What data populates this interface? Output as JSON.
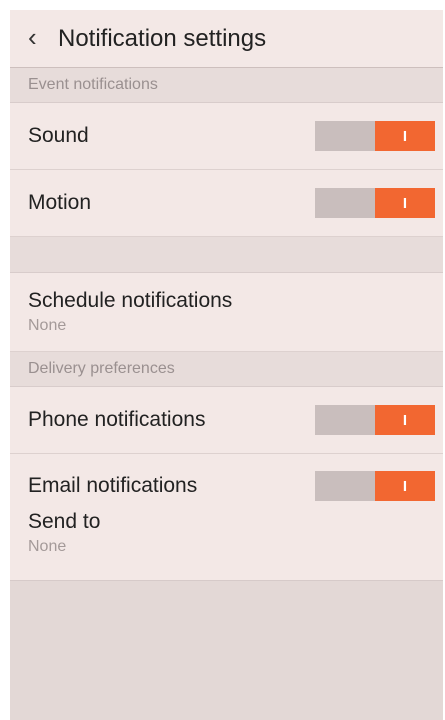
{
  "header": {
    "back_icon": "chevron-left-icon",
    "title": "Notification settings"
  },
  "sections": {
    "event": {
      "header": "Event notifications",
      "sound_label": "Sound",
      "motion_label": "Motion"
    },
    "schedule": {
      "label": "Schedule notifications",
      "value": "None"
    },
    "delivery": {
      "header": "Delivery preferences",
      "phone_label": "Phone notifications",
      "email_label": "Email notifications",
      "send_to_label": "Send to",
      "send_to_value": "None"
    }
  },
  "toggles": {
    "sound": {
      "on": true,
      "glyph": "I"
    },
    "motion": {
      "on": true,
      "glyph": "I"
    },
    "phone": {
      "on": true,
      "glyph": "I"
    },
    "email": {
      "on": true,
      "glyph": "I"
    }
  },
  "colors": {
    "accent": "#f26731",
    "toggle_off": "#c9bebd",
    "row_bg": "#f3e8e6",
    "section_bg": "#e7dcda"
  }
}
